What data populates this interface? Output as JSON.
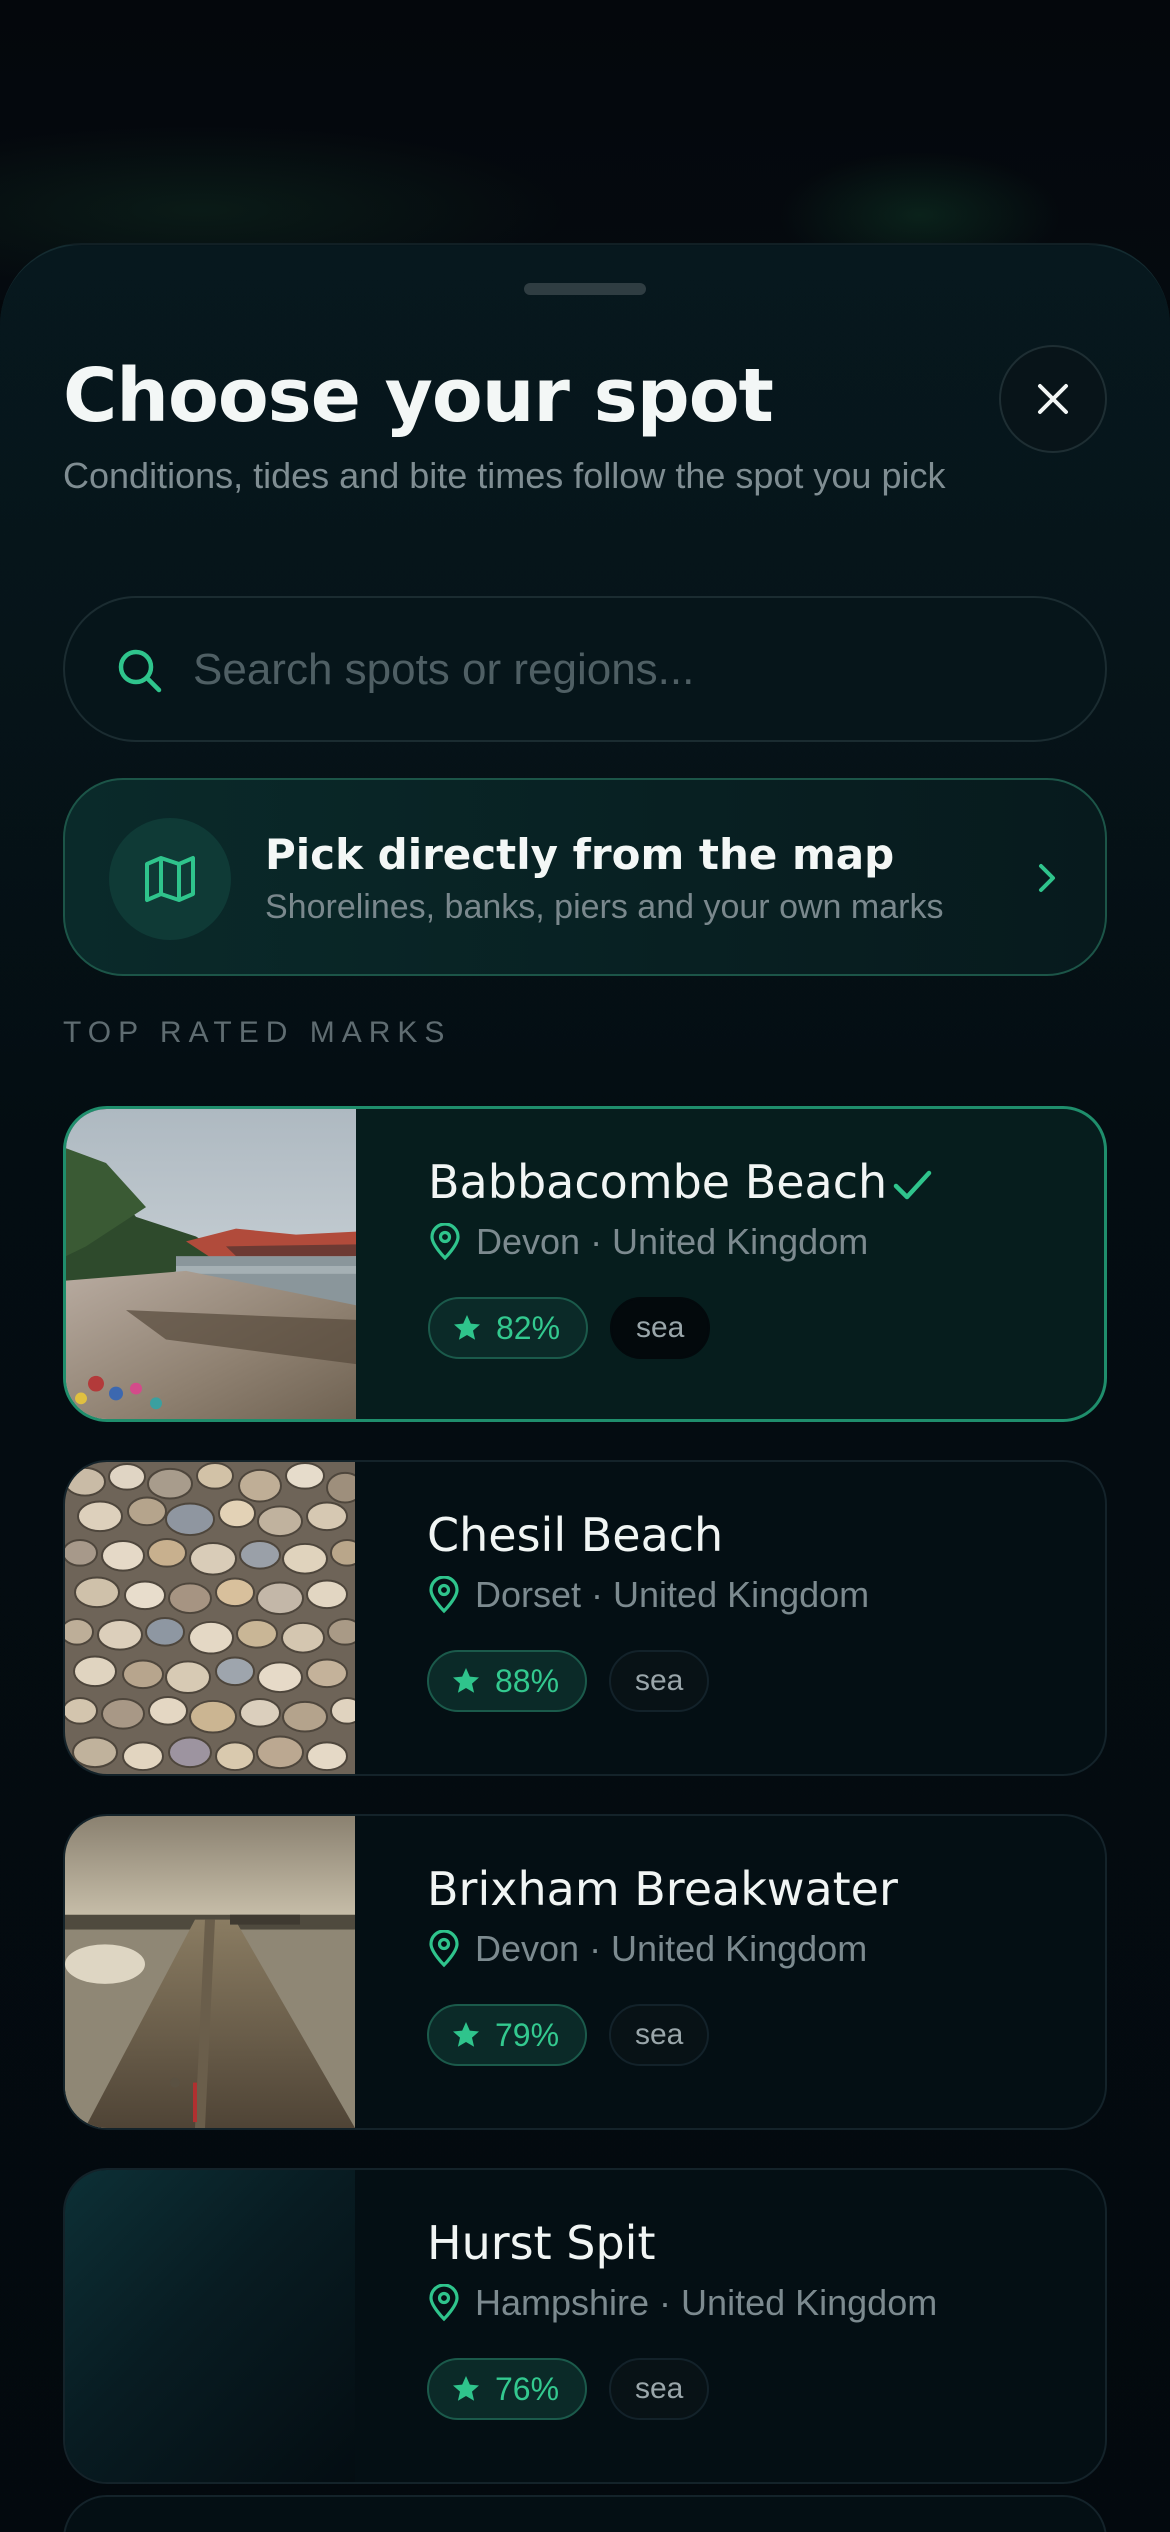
{
  "sheet": {
    "title": "Choose your spot",
    "subtitle": "Conditions, tides and bite times follow the spot you pick",
    "close_icon": "close-icon"
  },
  "search": {
    "placeholder": "Search spots or regions...",
    "value": "",
    "icon": "search-icon"
  },
  "map_pick": {
    "title": "Pick directly from the map",
    "subtitle": "Shorelines, banks, piers and your own marks",
    "icon": "map-icon",
    "chevron": "chevron-right-icon"
  },
  "section_label": "TOP RATED MARKS",
  "colors": {
    "accent": "#2fc48c",
    "background": "#03070b",
    "selected_border": "#1f8e6c"
  },
  "spots": [
    {
      "name": "Babbacombe Beach",
      "location": "Devon · United Kingdom",
      "rating": "82%",
      "tag": "sea",
      "selected": true
    },
    {
      "name": "Chesil Beach",
      "location": "Dorset · United Kingdom",
      "rating": "88%",
      "tag": "sea",
      "selected": false
    },
    {
      "name": "Brixham Breakwater",
      "location": "Devon · United Kingdom",
      "rating": "79%",
      "tag": "sea",
      "selected": false
    },
    {
      "name": "Hurst Spit",
      "location": "Hampshire · United Kingdom",
      "rating": "76%",
      "tag": "sea",
      "selected": false
    }
  ]
}
